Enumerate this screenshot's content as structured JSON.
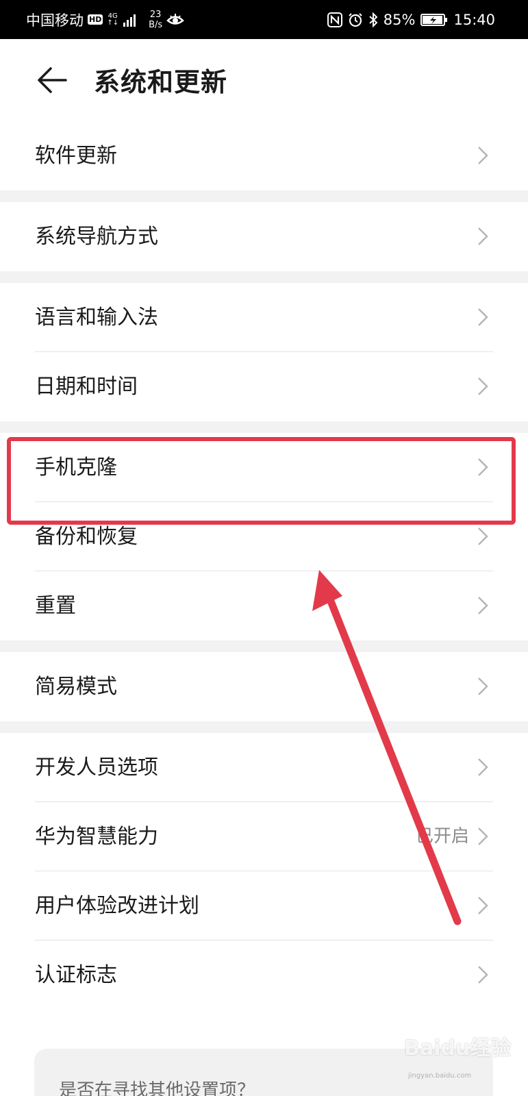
{
  "status_bar": {
    "carrier": "中国移动",
    "hd": "HD",
    "network": "4G",
    "speed_value": "23",
    "speed_unit": "B/s",
    "battery": "85%",
    "time": "15:40"
  },
  "header": {
    "title": "系统和更新"
  },
  "groups": [
    {
      "items": [
        {
          "label": "软件更新"
        }
      ]
    },
    {
      "items": [
        {
          "label": "系统导航方式"
        }
      ]
    },
    {
      "items": [
        {
          "label": "语言和输入法"
        },
        {
          "label": "日期和时间"
        }
      ]
    },
    {
      "items": [
        {
          "label": "手机克隆"
        },
        {
          "label": "备份和恢复"
        },
        {
          "label": "重置"
        }
      ]
    },
    {
      "items": [
        {
          "label": "简易模式"
        }
      ]
    },
    {
      "items": [
        {
          "label": "开发人员选项"
        },
        {
          "label": "华为智慧能力",
          "value": "已开启"
        },
        {
          "label": "用户体验改进计划"
        },
        {
          "label": "认证标志"
        }
      ]
    }
  ],
  "suggestion": {
    "text": "是否在寻找其他设置项？"
  },
  "watermark": {
    "text": "Baidu经验",
    "sub": "jingyan.baidu.com"
  },
  "colors": {
    "annotation": "#e23a4a",
    "gap": "#f2f2f2",
    "secondary_text": "#8c8c8c"
  }
}
